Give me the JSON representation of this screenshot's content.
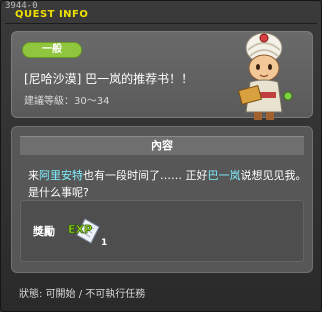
{
  "window": {
    "id": "3944-0",
    "title": "QUEST INFO"
  },
  "quest": {
    "type": "一般",
    "name": "[尼哈沙漠] 巴一岚的推荐书！！",
    "level": "建議等級：30～34"
  },
  "content": {
    "header": "內容",
    "text_segments": [
      {
        "text": "来",
        "highlight": false
      },
      {
        "text": "阿里安特",
        "highlight": true
      },
      {
        "text": "也有一段时间了…… 正好",
        "highlight": false
      },
      {
        "text": "巴一岚",
        "highlight": true
      },
      {
        "text": "说想见见我。是什么事呢?",
        "highlight": false
      }
    ]
  },
  "reward": {
    "label": "獎勵",
    "item_icon": "exp-icon",
    "count": "1"
  },
  "status": "狀態: 可開始 / 不可執行任務",
  "colors": {
    "title": "#f0e000",
    "badge": "#8fc63e",
    "highlight": "#7ff0ff"
  }
}
